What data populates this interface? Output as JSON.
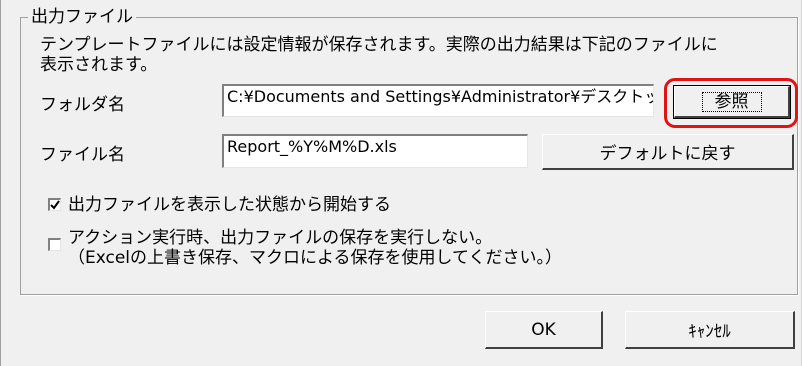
{
  "group": {
    "title": "出力ファイル",
    "description_line1": "テンプレートファイルには設定情報が保存されます。実際の出力結果は下記のファイルに",
    "description_line2": "表示されます。"
  },
  "folder": {
    "label": "フォルダ名",
    "value": "C:¥Documents and Settings¥Administrator¥デスクトップ",
    "browse_label": "参照"
  },
  "file": {
    "label": "ファイル名",
    "value": "Report_%Y%M%D.xls",
    "default_label": "デフォルトに戻す"
  },
  "options": {
    "open_output": {
      "label": "出力ファイルを表示した状態から開始する",
      "checked": true
    },
    "no_save": {
      "label_line1": "アクション実行時、出力ファイルの保存を実行しない。",
      "label_line2": "（Excelの上書き保存、マクロによる保存を使用してください。）",
      "checked": false
    }
  },
  "footer": {
    "ok_label": "OK",
    "cancel_label": "ｷｬﾝｾﾙ"
  },
  "colors": {
    "highlight": "#e01414",
    "dialog_bg": "#f0f0f0"
  }
}
